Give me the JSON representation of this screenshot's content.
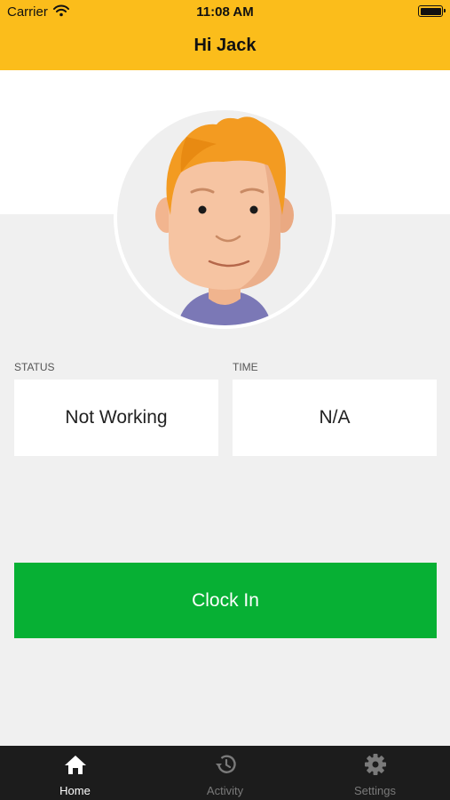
{
  "status_bar": {
    "carrier": "Carrier",
    "time": "11:08 AM"
  },
  "header": {
    "title": "Hi Jack",
    "background": "#fbbd1b"
  },
  "profile": {
    "avatar_icon": "cartoon-man-avatar"
  },
  "status": {
    "label": "STATUS",
    "value": "Not Working"
  },
  "time": {
    "label": "TIME",
    "value": "N/A"
  },
  "action": {
    "label": "Clock In",
    "color": "#07b034"
  },
  "tabbar": {
    "items": [
      {
        "label": "Home",
        "icon": "home-icon",
        "active": true
      },
      {
        "label": "Activity",
        "icon": "history-icon",
        "active": false
      },
      {
        "label": "Settings",
        "icon": "gear-icon",
        "active": false
      }
    ]
  }
}
